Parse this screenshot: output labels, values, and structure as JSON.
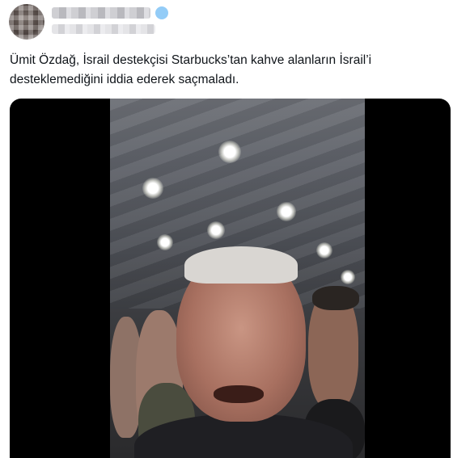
{
  "tweet": {
    "text": "Ümit Özdağ, İsrail destekçisi Starbucks’tan kahve alanların İsrail’i desteklemediğini iddia ederek saçmaladı."
  },
  "icons": {
    "verified": "verified-badge-icon"
  },
  "colors": {
    "text": "#0f1419",
    "verified": "#3ba3f0",
    "media_background": "#000000"
  }
}
